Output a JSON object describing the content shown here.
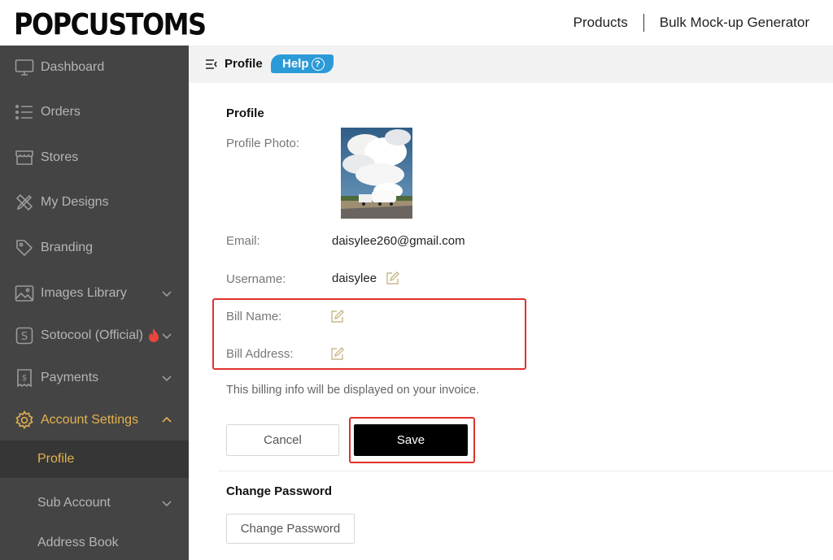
{
  "header": {
    "logo": "POPCUSTOMS",
    "nav": [
      "Products",
      "Bulk Mock-up Generator"
    ]
  },
  "sidebar": {
    "items": [
      {
        "label": "Dashboard",
        "icon": "monitor-icon"
      },
      {
        "label": "Orders",
        "icon": "list-icon"
      },
      {
        "label": "Stores",
        "icon": "store-icon"
      },
      {
        "label": "My Designs",
        "icon": "pencil-ruler-icon"
      },
      {
        "label": "Branding",
        "icon": "tag-icon"
      },
      {
        "label": "Images Library",
        "icon": "image-icon"
      },
      {
        "label": "Sotocool (Official)",
        "icon": "s-badge-icon"
      },
      {
        "label": "Payments",
        "icon": "receipt-icon"
      },
      {
        "label": "Account Settings",
        "icon": "gear-icon"
      }
    ],
    "sub_items": [
      "Profile",
      "Sub Account",
      "Address Book"
    ]
  },
  "content_header": {
    "title": "Profile",
    "help_label": "Help",
    "help_q": "?"
  },
  "profile": {
    "section_title": "Profile",
    "photo_label": "Profile Photo:",
    "email_label": "Email:",
    "email_value": "daisylee260@gmail.com",
    "username_label": "Username:",
    "username_value": "daisylee",
    "bill_name_label": "Bill Name:",
    "bill_address_label": "Bill Address:",
    "note": "This billing info will be displayed on your invoice.",
    "cancel_label": "Cancel",
    "save_label": "Save"
  },
  "password": {
    "section_title": "Change Password",
    "button_label": "Change Password"
  },
  "colors": {
    "sidebar_bg": "#444444",
    "sidebar_active": "#e3b34f",
    "help_blue": "#2d9ad8",
    "highlight_red": "#e0312c"
  }
}
